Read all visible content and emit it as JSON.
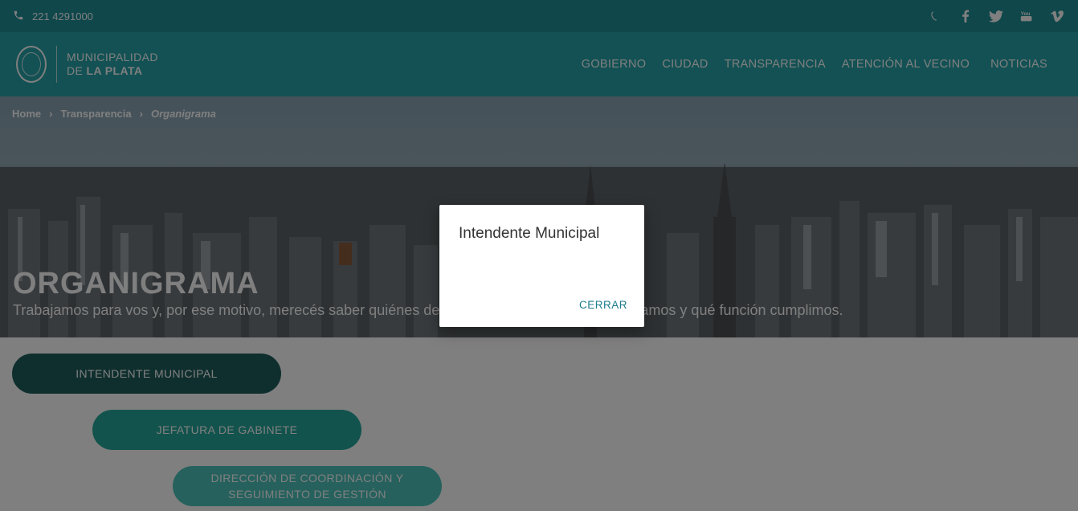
{
  "topbar": {
    "phone": "221 4291000",
    "socials": [
      "whatsapp-icon",
      "facebook-icon",
      "twitter-icon",
      "youtube-icon",
      "vimeo-icon"
    ]
  },
  "header": {
    "logo_line1": "MUNICIPALIDAD",
    "logo_line2_prefix": "DE",
    "logo_line2_bold": "LA PLATA",
    "nav": [
      "GOBIERNO",
      "CIUDAD",
      "TRANSPARENCIA",
      "ATENCIÓN AL VECINO",
      "NOTICIAS"
    ]
  },
  "breadcrumb": {
    "home": "Home",
    "section": "Transparencia",
    "current": "Organigrama"
  },
  "hero": {
    "title": "ORGANIGRAMA",
    "subtitle": "Trabajamos para vos y, por ese motivo, merecés saber quiénes desde el Gobierno nos desempeñamos y qué función cumplimos."
  },
  "org": {
    "nodes": [
      "INTENDENTE MUNICIPAL",
      "JEFATURA DE GABINETE",
      "DIRECCIÓN DE COORDINACIÓN Y SEGUIMIENTO DE GESTIÓN"
    ]
  },
  "modal": {
    "title": "Intendente Municipal",
    "close_label": "CERRAR"
  },
  "colors": {
    "topbar": "#1e8f96",
    "header": "#27a2a9",
    "node_dark": "#1f5e5d",
    "node_mid": "#26a69a",
    "node_light": "#4cc3bb",
    "link": "#1d7d8c"
  }
}
